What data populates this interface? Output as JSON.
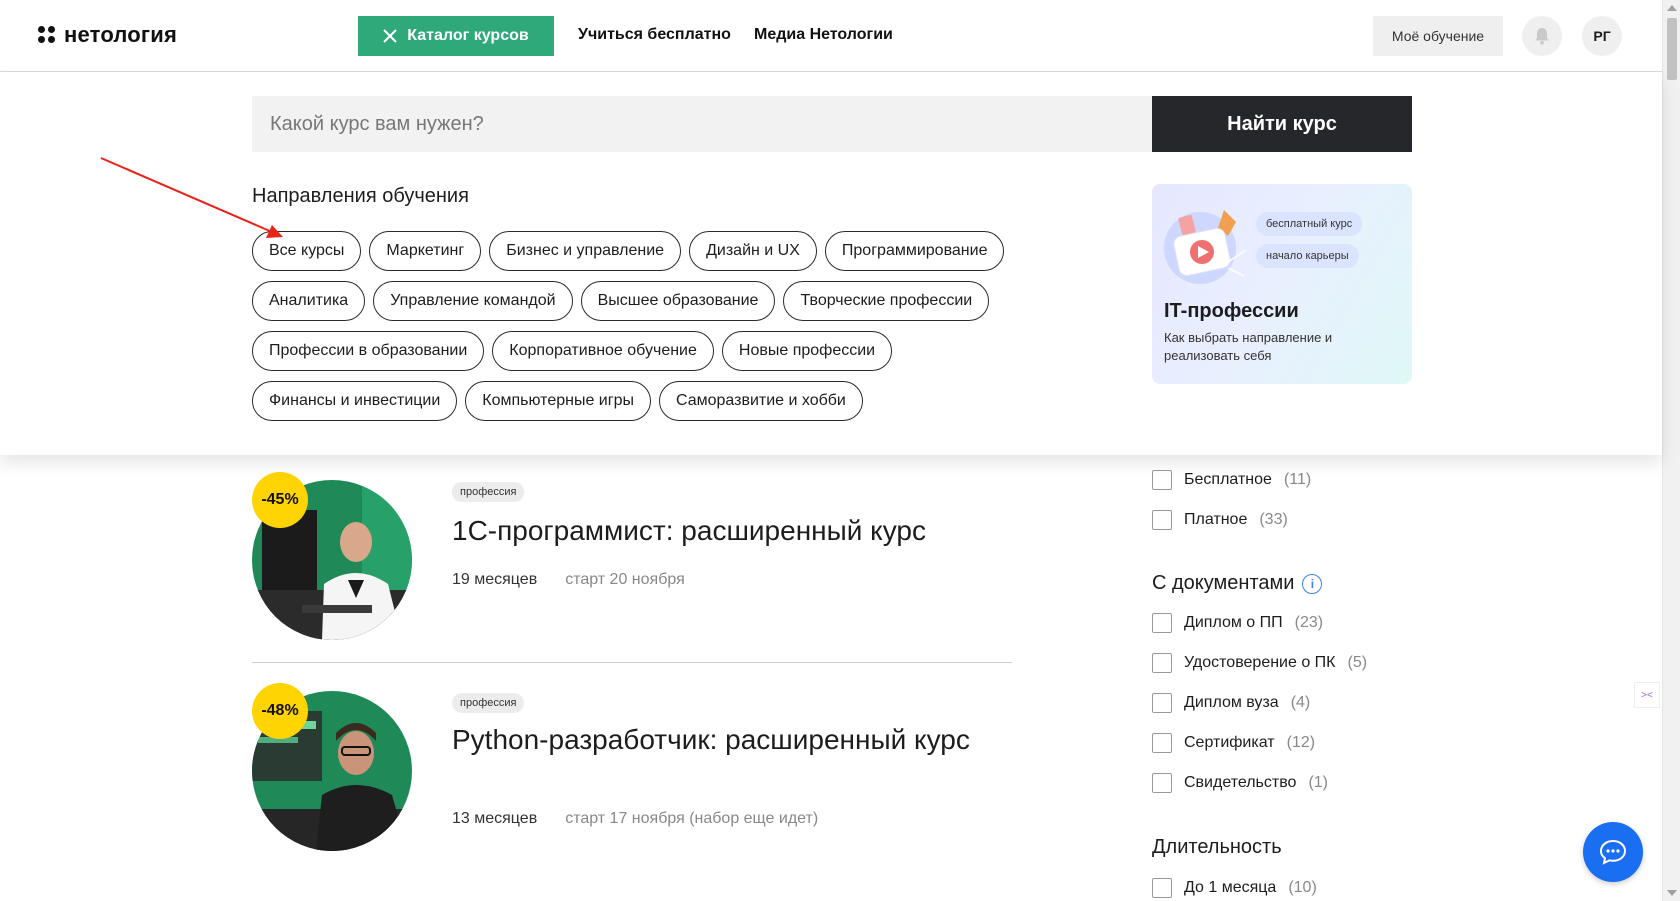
{
  "header": {
    "logo_text": "нетология",
    "catalog_button": "Каталог курсов",
    "nav": [
      "Учиться бесплатно",
      "Медиа Нетологии"
    ],
    "my_learning": "Моё обучение",
    "avatar_initials": "РГ"
  },
  "search": {
    "placeholder": "Какой курс вам нужен?",
    "button": "Найти курс"
  },
  "directions": {
    "title": "Направления обучения",
    "rows": [
      [
        "Все курсы",
        "Маркетинг",
        "Бизнес и управление",
        "Дизайн и UX",
        "Программирование"
      ],
      [
        "Аналитика",
        "Управление командой",
        "Высшее образование",
        "Творческие профессии"
      ],
      [
        "Профессии в образовании",
        "Корпоративное обучение",
        "Новые профессии"
      ],
      [
        "Финансы и инвестиции",
        "Компьютерные игры",
        "Саморазвитие и хобби"
      ]
    ]
  },
  "promo": {
    "badges": [
      "бесплатный курс",
      "начало карьеры"
    ],
    "title": "IT-профессии",
    "description": "Как выбрать направление и реализовать себя"
  },
  "courses": [
    {
      "discount": "-45%",
      "tag": "профессия",
      "title": "1С-программист: расширенный курс",
      "duration": "19 месяцев",
      "start": "старт 20 ноября"
    },
    {
      "discount": "-48%",
      "tag": "профессия",
      "title": "Python-разработчик: расширенный курс",
      "duration": "13 месяцев",
      "start": "старт 17 ноября (набор еще идет)"
    }
  ],
  "filters": {
    "price": [
      {
        "label": "Бесплатное",
        "count": "(11)"
      },
      {
        "label": "Платное",
        "count": "(33)"
      }
    ],
    "docs_heading": "С документами",
    "docs": [
      {
        "label": "Диплом о ПП",
        "count": "(23)"
      },
      {
        "label": "Удостоверение о ПК",
        "count": "(5)"
      },
      {
        "label": "Диплом вуза",
        "count": "(4)"
      },
      {
        "label": "Сертификат",
        "count": "(12)"
      },
      {
        "label": "Свидетельство",
        "count": "(1)"
      }
    ],
    "duration_heading": "Длительность",
    "duration": [
      {
        "label": "До 1 месяца",
        "count": "(10)"
      }
    ]
  },
  "colors": {
    "accent_green": "#2fa87a",
    "dark_button": "#26272b",
    "discount_yellow": "#ffd400",
    "chat_blue": "#1a6ef2",
    "arrow_red": "#e8231a"
  },
  "icons": {
    "catalog_close": "close-icon",
    "bell": "bell-icon",
    "info": "info-icon",
    "chat": "chat-icon"
  }
}
